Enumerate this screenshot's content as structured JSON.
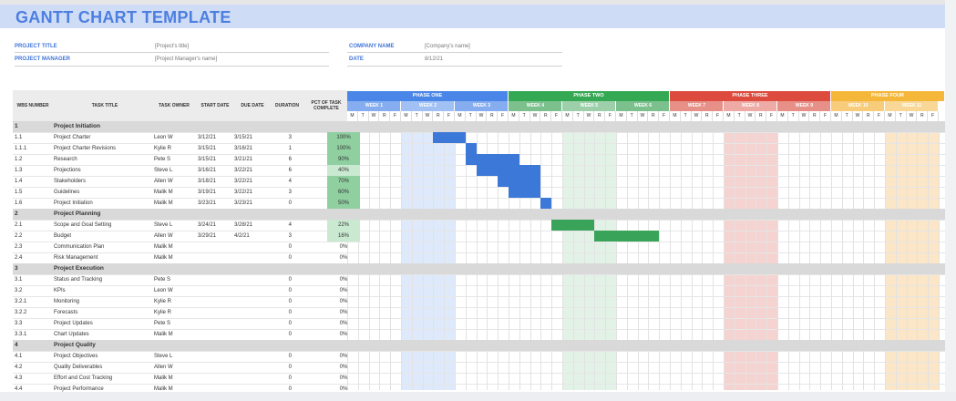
{
  "title": "GANTT CHART TEMPLATE",
  "meta": {
    "project_title_label": "PROJECT TITLE",
    "project_title_value": "[Project's title]",
    "project_manager_label": "PROJECT MANAGER",
    "project_manager_value": "[Project Manager's name]",
    "company_name_label": "COMPANY NAME",
    "company_name_value": "[Company's name]",
    "date_label": "DATE",
    "date_value": "8/12/21"
  },
  "headers": {
    "wbs": "WBS NUMBER",
    "task": "TASK TITLE",
    "owner": "TASK OWNER",
    "start": "START DATE",
    "due": "DUE DATE",
    "duration": "DURATION",
    "pct_line1": "PCT OF TASK",
    "pct_line2": "COMPLETE"
  },
  "phases": [
    {
      "label": "PHASE ONE",
      "color": "#4a86e8"
    },
    {
      "label": "PHASE TWO",
      "color": "#34a853"
    },
    {
      "label": "PHASE THREE",
      "color": "#dd4b3e"
    },
    {
      "label": "PHASE FOUR",
      "color": "#f4b73a"
    }
  ],
  "weeks": [
    {
      "label": "WEEK 1",
      "color": "#85adf0"
    },
    {
      "label": "WEEK 2",
      "color": "#a1c0f3"
    },
    {
      "label": "WEEK 3",
      "color": "#85adf0"
    },
    {
      "label": "WEEK 4",
      "color": "#7cc08e"
    },
    {
      "label": "WEEK 5",
      "color": "#9dd0aa"
    },
    {
      "label": "WEEK 6",
      "color": "#7cc08e"
    },
    {
      "label": "WEEK 7",
      "color": "#e69088"
    },
    {
      "label": "WEEK 8",
      "color": "#eeaaa4"
    },
    {
      "label": "WEEK 9",
      "color": "#e69088"
    },
    {
      "label": "WEEK 10",
      "color": "#f7cc7b"
    },
    {
      "label": "WEEK 11",
      "color": "#f9d897"
    }
  ],
  "day_letters": [
    "M",
    "T",
    "W",
    "R",
    "F"
  ],
  "colors": {
    "bar_blue": "#3c78d8",
    "bar_green": "#3aa35a",
    "pct_green_dark": "#8fcfa0",
    "pct_green_light": "#c9e9d1"
  },
  "rows": [
    {
      "type": "section",
      "wbs": "1",
      "task": "Project Initiation"
    },
    {
      "type": "task",
      "wbs": "1.1",
      "task": "Project Charter",
      "owner": "Leon W",
      "start": "3/12/21",
      "due": "3/15/21",
      "duration": "3",
      "pct": "100%",
      "pct_fill": 1.0,
      "bar_start": 8,
      "bar_len": 3,
      "bar_color": "blue"
    },
    {
      "type": "task",
      "wbs": "1.1.1",
      "task": "Project Charter Revisions",
      "owner": "Kylie R",
      "start": "3/15/21",
      "due": "3/16/21",
      "duration": "1",
      "pct": "100%",
      "pct_fill": 1.0,
      "bar_start": 11,
      "bar_len": 1,
      "bar_color": "blue"
    },
    {
      "type": "task",
      "wbs": "1.2",
      "task": "Research",
      "owner": "Pete S",
      "start": "3/15/21",
      "due": "3/21/21",
      "duration": "6",
      "pct": "90%",
      "pct_fill": 0.9,
      "bar_start": 11,
      "bar_len": 5,
      "bar_color": "blue"
    },
    {
      "type": "task",
      "wbs": "1.3",
      "task": "Projections",
      "owner": "Steve L",
      "start": "3/16/21",
      "due": "3/22/21",
      "duration": "6",
      "pct": "40%",
      "pct_fill": 0.4,
      "bar_start": 12,
      "bar_len": 6,
      "bar_color": "blue"
    },
    {
      "type": "task",
      "wbs": "1.4",
      "task": "Stakeholders",
      "owner": "Allen W",
      "start": "3/18/21",
      "due": "3/22/21",
      "duration": "4",
      "pct": "70%",
      "pct_fill": 0.7,
      "bar_start": 14,
      "bar_len": 4,
      "bar_color": "blue"
    },
    {
      "type": "task",
      "wbs": "1.5",
      "task": "Guidelines",
      "owner": "Malik M",
      "start": "3/19/21",
      "due": "3/22/21",
      "duration": "3",
      "pct": "60%",
      "pct_fill": 0.6,
      "bar_start": 15,
      "bar_len": 3,
      "bar_color": "blue"
    },
    {
      "type": "task",
      "wbs": "1.6",
      "task": "Project Initiation",
      "owner": "Malik M",
      "start": "3/23/21",
      "due": "3/23/21",
      "duration": "0",
      "pct": "50%",
      "pct_fill": 0.5,
      "bar_start": 18,
      "bar_len": 1,
      "bar_color": "blue"
    },
    {
      "type": "section",
      "wbs": "2",
      "task": "Project Planning"
    },
    {
      "type": "task",
      "wbs": "2.1",
      "task": "Scope and Goal Setting",
      "owner": "Steve L",
      "start": "3/24/21",
      "due": "3/28/21",
      "duration": "4",
      "pct": "22%",
      "pct_fill": 0.22,
      "bar_start": 19,
      "bar_len": 4,
      "bar_color": "green"
    },
    {
      "type": "task",
      "wbs": "2.2",
      "task": "Budget",
      "owner": "Allen W",
      "start": "3/29/21",
      "due": "4/2/21",
      "duration": "3",
      "pct": "16%",
      "pct_fill": 0.16,
      "bar_start": 23,
      "bar_len": 6,
      "bar_color": "green"
    },
    {
      "type": "task",
      "wbs": "2.3",
      "task": "Communication Plan",
      "owner": "Malik M",
      "start": "",
      "due": "",
      "duration": "0",
      "pct": "0%",
      "pct_fill": 0
    },
    {
      "type": "task",
      "wbs": "2.4",
      "task": "Risk Management",
      "owner": "Malik M",
      "start": "",
      "due": "",
      "duration": "0",
      "pct": "0%",
      "pct_fill": 0
    },
    {
      "type": "section",
      "wbs": "3",
      "task": "Project Execution"
    },
    {
      "type": "task",
      "wbs": "3.1",
      "task": "Status and Tracking",
      "owner": "Pete S",
      "start": "",
      "due": "",
      "duration": "0",
      "pct": "0%",
      "pct_fill": 0
    },
    {
      "type": "task",
      "wbs": "3.2",
      "task": "KPIs",
      "owner": "Leon W",
      "start": "",
      "due": "",
      "duration": "0",
      "pct": "0%",
      "pct_fill": 0
    },
    {
      "type": "task",
      "wbs": "3.2.1",
      "task": "Monitoring",
      "owner": "Kylie R",
      "start": "",
      "due": "",
      "duration": "0",
      "pct": "0%",
      "pct_fill": 0
    },
    {
      "type": "task",
      "wbs": "3.2.2",
      "task": "Forecasts",
      "owner": "Kylie R",
      "start": "",
      "due": "",
      "duration": "0",
      "pct": "0%",
      "pct_fill": 0
    },
    {
      "type": "task",
      "wbs": "3.3",
      "task": "Project Updates",
      "owner": "Pete S",
      "start": "",
      "due": "",
      "duration": "0",
      "pct": "0%",
      "pct_fill": 0
    },
    {
      "type": "task",
      "wbs": "3.3.1",
      "task": "Chart Updates",
      "owner": "Malik M",
      "start": "",
      "due": "",
      "duration": "0",
      "pct": "0%",
      "pct_fill": 0
    },
    {
      "type": "section",
      "wbs": "4",
      "task": "Project Quality"
    },
    {
      "type": "task",
      "wbs": "4.1",
      "task": "Project Objectives",
      "owner": "Steve L",
      "start": "",
      "due": "",
      "duration": "0",
      "pct": "0%",
      "pct_fill": 0
    },
    {
      "type": "task",
      "wbs": "4.2",
      "task": "Quality Deliverables",
      "owner": "Allen W",
      "start": "",
      "due": "",
      "duration": "0",
      "pct": "0%",
      "pct_fill": 0
    },
    {
      "type": "task",
      "wbs": "4.3",
      "task": "Effort and Cost Tracking",
      "owner": "Malik M",
      "start": "",
      "due": "",
      "duration": "0",
      "pct": "0%",
      "pct_fill": 0
    },
    {
      "type": "task",
      "wbs": "4.4",
      "task": "Project Performance",
      "owner": "Malik M",
      "start": "",
      "due": "",
      "duration": "0",
      "pct": "0%",
      "pct_fill": 0
    }
  ]
}
